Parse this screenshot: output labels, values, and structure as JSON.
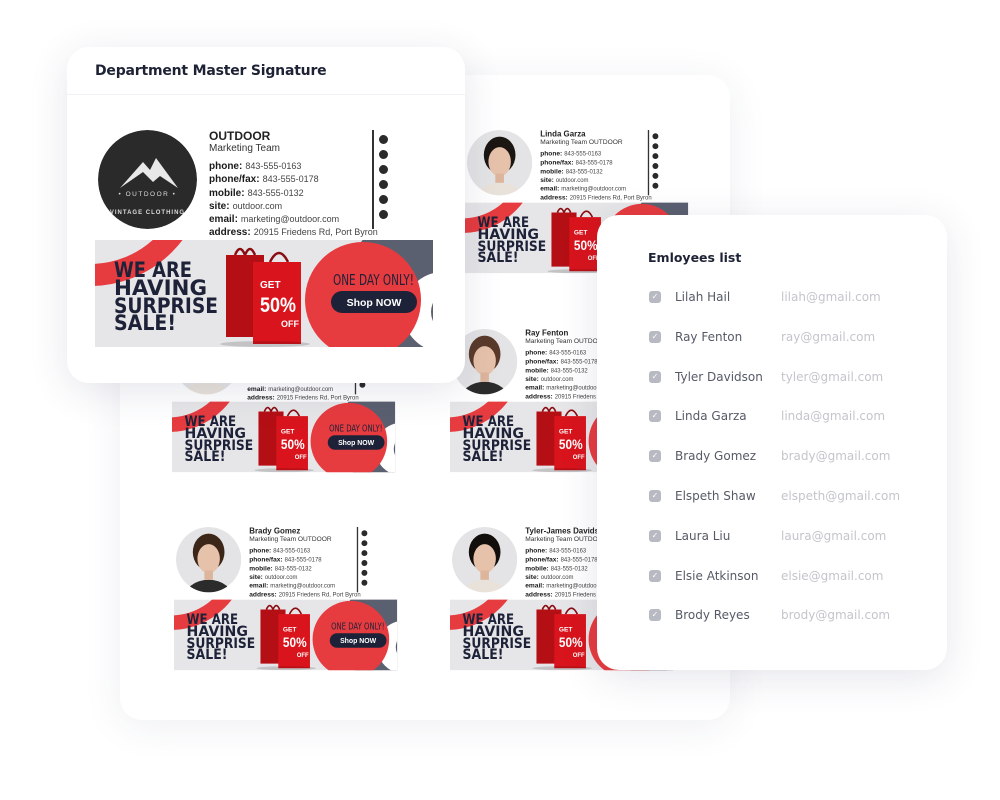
{
  "master": {
    "title": "Department Master Signature",
    "company": "OUTDOOR",
    "team": "Marketing Team",
    "logo_text": [
      "OUTDOOR",
      "VINTAGE CLOTHING"
    ]
  },
  "contact_fields": [
    {
      "label": "phone:",
      "value": "843-555-0163"
    },
    {
      "label": "phone/fax:",
      "value": "843-555-0178"
    },
    {
      "label": "mobile:",
      "value": "843-555-0132"
    },
    {
      "label": "site:",
      "value": "outdoor.com"
    },
    {
      "label": "email:",
      "value": "marketing@outdoor.com"
    },
    {
      "label": "address:",
      "value": "20915 Friedens Rd, Port Byron"
    }
  ],
  "social_icons": [
    "facebook-icon",
    "twitter-icon",
    "linkedin-icon",
    "instagram-icon",
    "pinterest-icon",
    "profile-icon"
  ],
  "banner": {
    "headline": [
      "WE ARE",
      "HAVING",
      "SURPRISE",
      "SALE!"
    ],
    "get": "GET",
    "percent": "50%",
    "off": "OFF",
    "tagline": "ONE DAY ONLY!",
    "cta": "Shop NOW",
    "colors": {
      "red": "#e63b3f",
      "navy": "#1d2238",
      "gray": "#5b6070",
      "bg": "#e6e6e8"
    }
  },
  "back_signatures": [
    {
      "name": "Linda Garza",
      "team": "Marketing Team OUTDOOR"
    },
    {
      "name": "Ray Fenton",
      "team": "Marketing Team OUTDOOR"
    },
    {
      "name": "",
      "team": ""
    },
    {
      "name": "Brady Gomez",
      "team": "Marketing Team OUTDOOR"
    },
    {
      "name": "Tyler-James Davidson",
      "team": "Marketing Team OUTDOOR"
    }
  ],
  "employees": {
    "title": "Emloyees list",
    "items": [
      {
        "name": "Lilah Hail",
        "email": "lilah@gmail.com",
        "checked": true
      },
      {
        "name": "Ray Fenton",
        "email": "ray@gmail.com",
        "checked": true
      },
      {
        "name": "Tyler Davidson",
        "email": "tyler@gmail.com",
        "checked": true
      },
      {
        "name": "Linda Garza",
        "email": "linda@gmail.com",
        "checked": true
      },
      {
        "name": "Brady Gomez",
        "email": "brady@gmail.com",
        "checked": true
      },
      {
        "name": "Elspeth Shaw",
        "email": "elspeth@gmail.com",
        "checked": true
      },
      {
        "name": "Laura Liu",
        "email": "laura@gmail.com",
        "checked": true
      },
      {
        "name": "Elsie Atkinson",
        "email": "elsie@gmail.com",
        "checked": true
      },
      {
        "name": "Brody Reyes",
        "email": "brody@gmail.com",
        "checked": true
      }
    ]
  }
}
